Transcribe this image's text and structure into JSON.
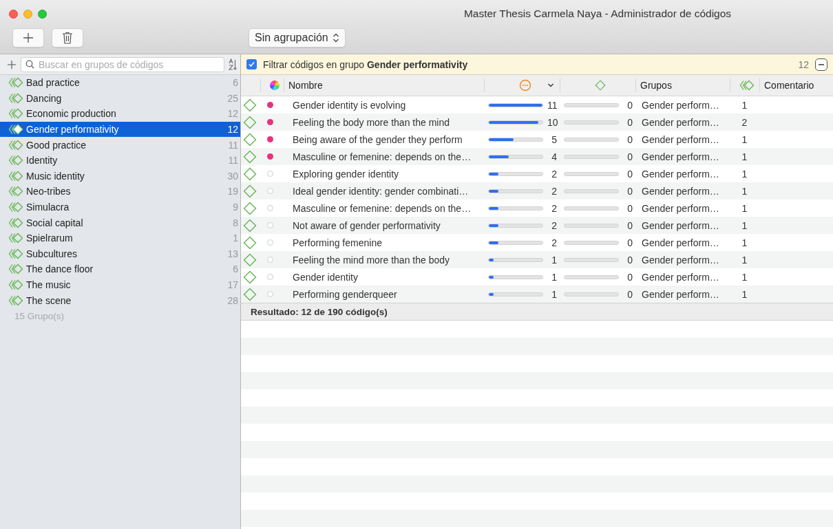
{
  "window": {
    "title": "Master Thesis Carmela Naya - Administrador de códigos"
  },
  "toolbar": {
    "grouping": "Sin agrupación"
  },
  "sidebar": {
    "search": {
      "placeholder": "Buscar en grupos de códigos"
    },
    "groups": [
      {
        "name": "Bad practice",
        "count": "6",
        "selected": false
      },
      {
        "name": "Dancing",
        "count": "25",
        "selected": false
      },
      {
        "name": "Economic production",
        "count": "12",
        "selected": false
      },
      {
        "name": "Gender performativity",
        "count": "12",
        "selected": true
      },
      {
        "name": "Good practice",
        "count": "11",
        "selected": false
      },
      {
        "name": "Identity",
        "count": "11",
        "selected": false
      },
      {
        "name": "Music identity",
        "count": "30",
        "selected": false
      },
      {
        "name": "Neo-tribes",
        "count": "19",
        "selected": false
      },
      {
        "name": "Simulacra",
        "count": "9",
        "selected": false
      },
      {
        "name": "Social capital",
        "count": "8",
        "selected": false
      },
      {
        "name": "Spielrarum",
        "count": "1",
        "selected": false
      },
      {
        "name": "Subcultures",
        "count": "13",
        "selected": false
      },
      {
        "name": "The dance floor",
        "count": "6",
        "selected": false
      },
      {
        "name": "The music",
        "count": "17",
        "selected": false
      },
      {
        "name": "The scene",
        "count": "28",
        "selected": false
      }
    ],
    "footer": "15 Grupo(s)"
  },
  "filter": {
    "checked": true,
    "label": "Filtrar códigos en grupo **Gender performativity**",
    "count": "12"
  },
  "table": {
    "columns": [
      {
        "kind": "color",
        "sorted": false
      },
      {
        "kind": "text",
        "label": "Nombre",
        "sorted": false
      },
      {
        "kind": "quotations",
        "sorted": true
      },
      {
        "kind": "codes",
        "sorted": false
      },
      {
        "kind": "text",
        "label": "Grupos",
        "sorted": false
      },
      {
        "kind": "groups",
        "sorted": false
      },
      {
        "kind": "text",
        "label": "Comentario",
        "sorted": false
      }
    ],
    "rows": [
      {
        "name": "Gender identity is evolving",
        "color": "#e8307f",
        "quotations": {
          "level": 1,
          "count": "11"
        },
        "links": {
          "level": 0,
          "count": "0"
        },
        "groups": "Gender perform…",
        "group_count": "1"
      },
      {
        "name": "Feeling the body more than the mind",
        "color": "#e8307f",
        "quotations": {
          "level": 0.92,
          "count": "10"
        },
        "links": {
          "level": 0,
          "count": "0"
        },
        "groups": "Gender perform…",
        "group_count": "2"
      },
      {
        "name": "Being aware of the gender they perform",
        "color": "#e8307f",
        "quotations": {
          "level": 0.46,
          "count": "5"
        },
        "links": {
          "level": 0,
          "count": "0"
        },
        "groups": "Gender perform…",
        "group_count": "1"
      },
      {
        "name": "Masculine or femenine: depends on the…",
        "color": "#e8307f",
        "quotations": {
          "level": 0.37,
          "count": "4"
        },
        "links": {
          "level": 0,
          "count": "0"
        },
        "groups": "Gender perform…",
        "group_count": "1"
      },
      {
        "name": "Exploring gender identity",
        "quotations": {
          "level": 0.18,
          "count": "2"
        },
        "links": {
          "level": 0,
          "count": "0"
        },
        "groups": "Gender perform…",
        "group_count": "1"
      },
      {
        "name": "Ideal gender identity: gender combinati…",
        "quotations": {
          "level": 0.18,
          "count": "2"
        },
        "links": {
          "level": 0,
          "count": "0"
        },
        "groups": "Gender perform…",
        "group_count": "1"
      },
      {
        "name": "Masculine or femenine: depends on the…",
        "quotations": {
          "level": 0.18,
          "count": "2"
        },
        "links": {
          "level": 0,
          "count": "0"
        },
        "groups": "Gender perform…",
        "group_count": "1"
      },
      {
        "name": "Not aware of gender performativity",
        "quotations": {
          "level": 0.18,
          "count": "2"
        },
        "links": {
          "level": 0,
          "count": "0"
        },
        "groups": "Gender perform…",
        "group_count": "1"
      },
      {
        "name": "Performing femenine",
        "quotations": {
          "level": 0.18,
          "count": "2"
        },
        "links": {
          "level": 0,
          "count": "0"
        },
        "groups": "Gender perform…",
        "group_count": "1"
      },
      {
        "name": "Feeling the mind more than the body",
        "quotations": {
          "level": 0.09,
          "count": "1"
        },
        "links": {
          "level": 0,
          "count": "0"
        },
        "groups": "Gender perform…",
        "group_count": "1"
      },
      {
        "name": "Gender identity",
        "quotations": {
          "level": 0.09,
          "count": "1"
        },
        "links": {
          "level": 0,
          "count": "0"
        },
        "groups": "Gender perform…",
        "group_count": "1"
      },
      {
        "name": "Performing genderqueer",
        "quotations": {
          "level": 0.09,
          "count": "1"
        },
        "links": {
          "level": 0,
          "count": "0"
        },
        "groups": "Gender perform…",
        "group_count": "1"
      }
    ]
  },
  "result": "Resultado: 12 de 190 código(s)"
}
